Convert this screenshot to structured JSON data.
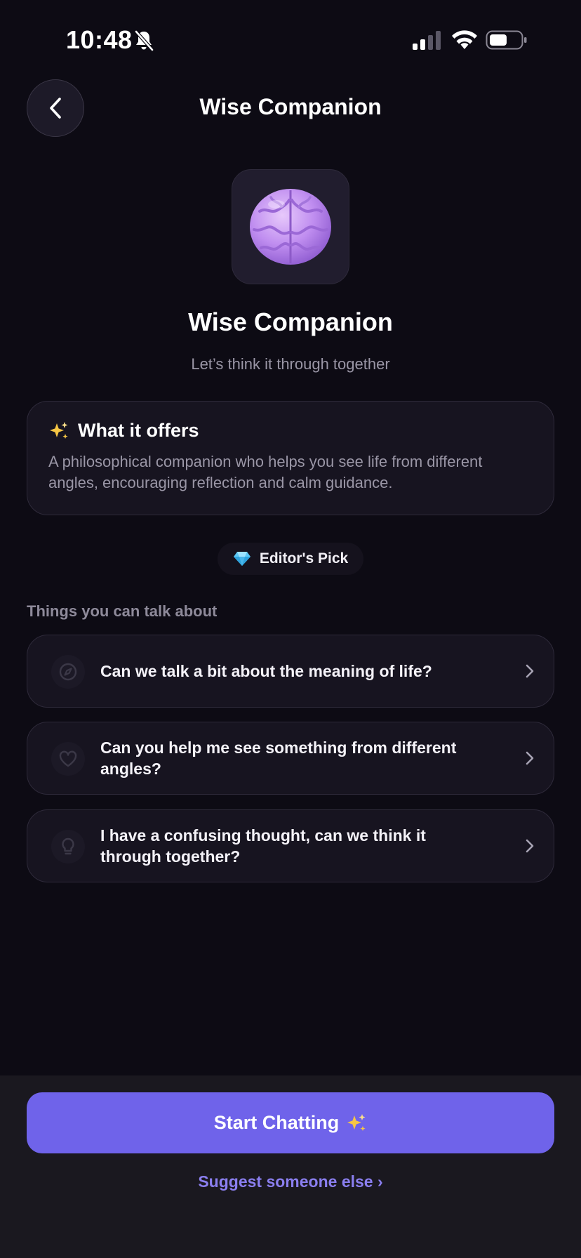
{
  "status_bar": {
    "time": "10:48",
    "icons": [
      "bell-slash-icon",
      "signal-icon",
      "wifi-icon",
      "battery-icon"
    ]
  },
  "header": {
    "title": "Wise Companion",
    "back_icon": "chevron-left-icon"
  },
  "companion": {
    "avatar_icon": "brain-icon",
    "name": "Wise Companion",
    "tagline": "Let’s think it through together"
  },
  "offers": {
    "icon": "sparkle-icon",
    "title": "What it offers",
    "description": "A philosophical companion who helps you see life from different angles, encouraging reflection and calm guidance."
  },
  "badge": {
    "icon": "gem-icon",
    "label": "Editor's Pick"
  },
  "topics": {
    "section_label": "Things you can talk about",
    "items": [
      {
        "icon": "compass-icon",
        "text": "Can we talk a bit about the meaning of life?"
      },
      {
        "icon": "heart-icon",
        "text": "Can you help me see something from different angles?"
      },
      {
        "icon": "lightbulb-icon",
        "text": "I have a confusing thought, can we think it through together?"
      }
    ]
  },
  "actions": {
    "start_label": "Start Chatting",
    "start_icon": "sparkle-icon",
    "suggest_label": "Suggest someone else ›"
  },
  "colors": {
    "background": "#0d0b14",
    "card": "#171420",
    "accent": "#6f63ea",
    "link": "#8b7ff0",
    "muted_text": "#9a96a6"
  }
}
